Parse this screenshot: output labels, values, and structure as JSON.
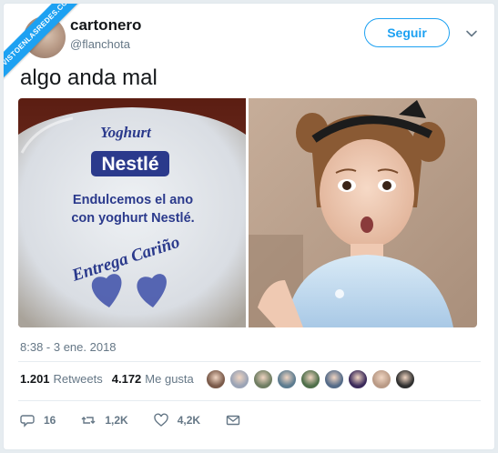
{
  "watermark": "VISTOENLASREDES.COM",
  "user": {
    "display_name": "cartonero",
    "handle": "@flanchota"
  },
  "follow_button": {
    "label": "Seguir"
  },
  "tweet": {
    "text": "algo anda mal",
    "timestamp": "8:38 - 3 ene. 2018"
  },
  "media": {
    "left_image": {
      "brand_top": "Yoghurt",
      "brand": "Nestlé",
      "line1": "Endulcemos el ano",
      "line2": "con yoghurt Nestlé.",
      "script_text": "Entrega Cariño"
    }
  },
  "stats": {
    "retweets_count": "1.201",
    "retweets_label": "Retweets",
    "likes_count": "4.172",
    "likes_label": "Me gusta"
  },
  "likers": [
    {
      "icon": "avatar",
      "color": "#7a5a4a"
    },
    {
      "icon": "avatar",
      "color": "#9aa3b5"
    },
    {
      "icon": "avatar",
      "color": "#6f7d62"
    },
    {
      "icon": "avatar",
      "color": "#5c7b8f"
    },
    {
      "icon": "avatar",
      "color": "#4f6f4a"
    },
    {
      "icon": "avatar",
      "color": "#556b88"
    },
    {
      "icon": "avatar",
      "color": "#3b2a5a"
    },
    {
      "icon": "avatar",
      "color": "#b99a86"
    },
    {
      "icon": "avatar",
      "color": "#2f2f2f"
    }
  ],
  "actions": {
    "replies": "16",
    "retweets": "1,2K",
    "likes": "4,2K"
  },
  "colors": {
    "accent": "#1da1f2",
    "text": "#14171a",
    "muted": "#657786"
  }
}
